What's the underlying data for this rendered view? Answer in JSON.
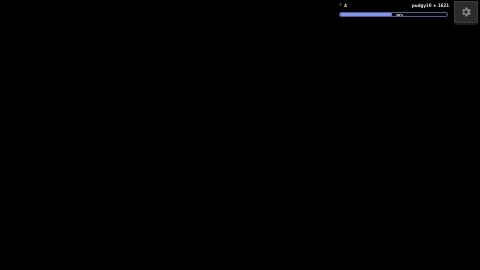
{
  "hud": {
    "energy_icon": "bolt-icon",
    "energy_value": "4",
    "player_label": "pudgy10 ★ 1621",
    "progress": {
      "percent": 49,
      "label": "49%",
      "fill_color": "#7f95ee"
    }
  },
  "settings": {
    "icon": "gear-icon"
  }
}
